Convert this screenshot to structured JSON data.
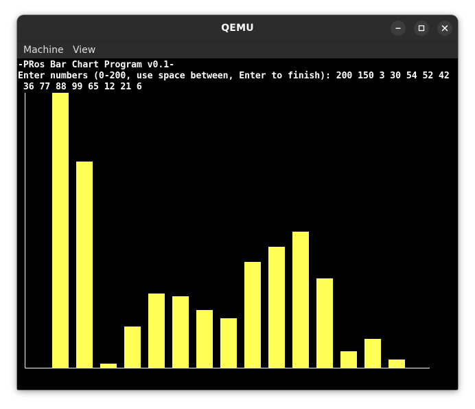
{
  "window": {
    "title": "QEMU"
  },
  "menubar": {
    "items": [
      {
        "label": "Machine"
      },
      {
        "label": "View"
      }
    ]
  },
  "terminal": {
    "header": "-PRos Bar Chart Program v0.1-",
    "prompt": "Enter numbers (0-200, use space between, Enter to finish): 200 150 3 30 54 52 42",
    "input_continuation": " 36 77 88 99 65 12 21 6"
  },
  "colors": {
    "bar": "#ffff55",
    "axis": "#ffffff",
    "screen_bg": "#000000",
    "titlebar_bg": "#2c2c2c"
  },
  "icons": {
    "minimize": "minimize-icon",
    "maximize": "maximize-icon",
    "close": "close-icon"
  },
  "chart_data": {
    "type": "bar",
    "values": [
      200,
      150,
      3,
      30,
      54,
      52,
      42,
      36,
      77,
      88,
      99,
      65,
      12,
      21,
      6
    ],
    "ylim": [
      0,
      200
    ]
  }
}
